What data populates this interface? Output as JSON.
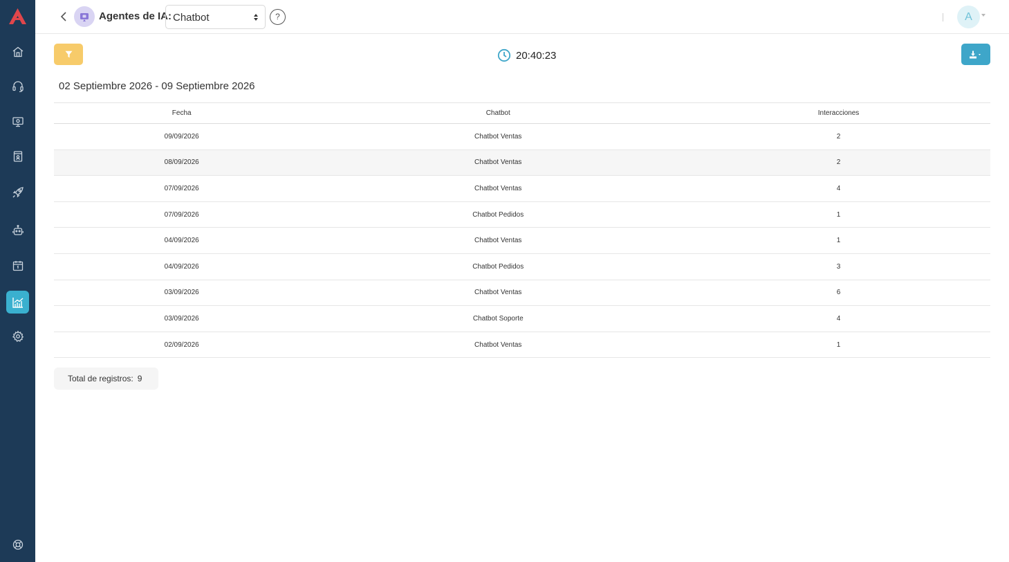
{
  "header": {
    "agent_label": "Agentes de IA:",
    "selected_agent": "Chatbot",
    "help_label": "?",
    "avatar_initial": "A"
  },
  "sidebar": {
    "items": [
      {
        "icon": "home-icon"
      },
      {
        "icon": "headset-icon"
      },
      {
        "icon": "monitor-icon"
      },
      {
        "icon": "contacts-book-icon"
      },
      {
        "icon": "rocket-icon"
      },
      {
        "icon": "robot-icon"
      },
      {
        "icon": "calendar-icon"
      },
      {
        "icon": "analytics-chart-icon",
        "active": true
      },
      {
        "icon": "gear-icon"
      },
      {
        "icon": "lifebuoy-icon"
      }
    ]
  },
  "toolbar": {
    "time": "20:40:23"
  },
  "date_range": "02 Septiembre 2026 - 09 Septiembre 2026",
  "table": {
    "headers": [
      "Fecha",
      "Chatbot",
      "Interacciones"
    ],
    "rows": [
      [
        "09/09/2026",
        "Chatbot Ventas",
        "2"
      ],
      [
        "08/09/2026",
        "Chatbot Ventas",
        "2"
      ],
      [
        "07/09/2026",
        "Chatbot Ventas",
        "4"
      ],
      [
        "07/09/2026",
        "Chatbot Pedidos",
        "1"
      ],
      [
        "04/09/2026",
        "Chatbot Ventas",
        "1"
      ],
      [
        "04/09/2026",
        "Chatbot Pedidos",
        "3"
      ],
      [
        "03/09/2026",
        "Chatbot Ventas",
        "6"
      ],
      [
        "03/09/2026",
        "Chatbot Soporte",
        "4"
      ],
      [
        "02/09/2026",
        "Chatbot Ventas",
        "1"
      ]
    ]
  },
  "footer": {
    "total_label": "Total de registros:",
    "total_value": "9"
  },
  "colors": {
    "sidebar": "#1d3a57",
    "accent": "#3ab0cf",
    "filter": "#f7cb6a",
    "logo": "#e0464b"
  }
}
